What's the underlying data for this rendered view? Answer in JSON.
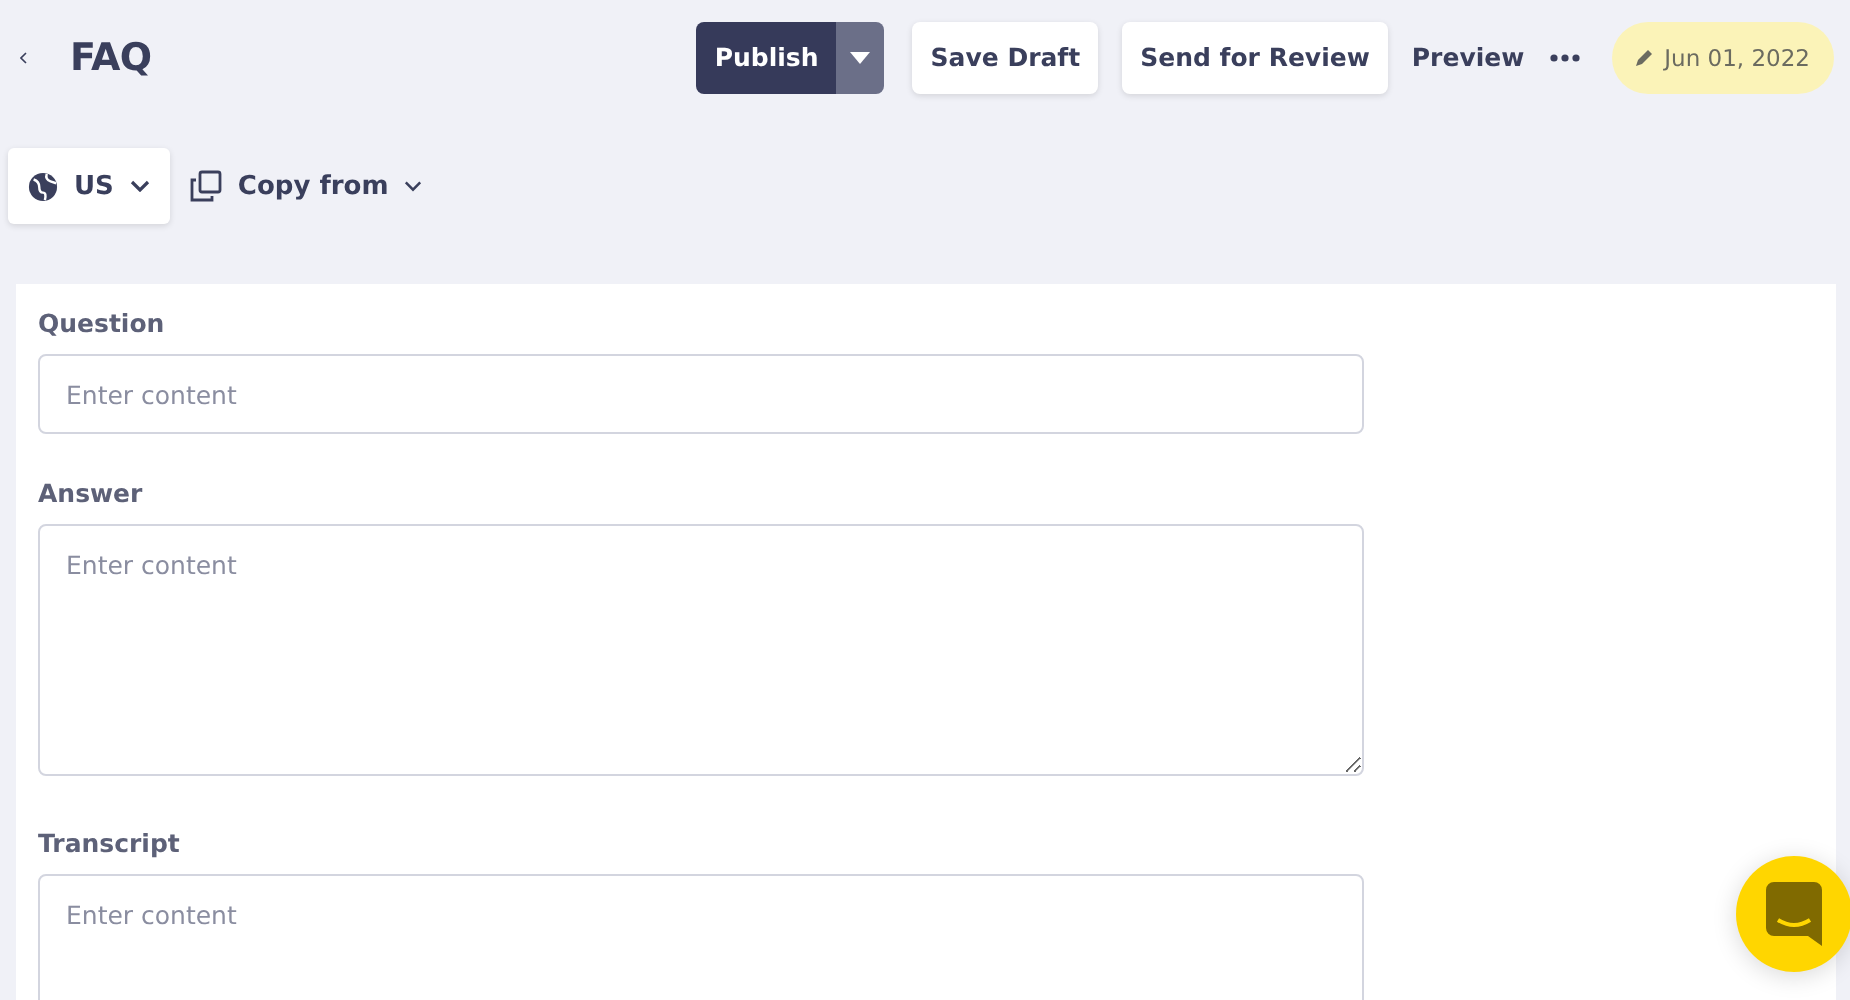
{
  "header": {
    "title": "FAQ",
    "publish": "Publish",
    "buttons": [
      "Save Draft",
      "Send for Review"
    ],
    "preview": "Preview",
    "date": "Jun 01, 2022"
  },
  "toolbar": {
    "locale": "US",
    "copy_from": "Copy from"
  },
  "fields": [
    {
      "label": "Question",
      "kind": "input",
      "placeholder": "Enter content"
    },
    {
      "label": "Answer",
      "kind": "textarea",
      "placeholder": "Enter content"
    },
    {
      "label": "Transcript",
      "kind": "textarea",
      "placeholder": "Enter content"
    }
  ]
}
